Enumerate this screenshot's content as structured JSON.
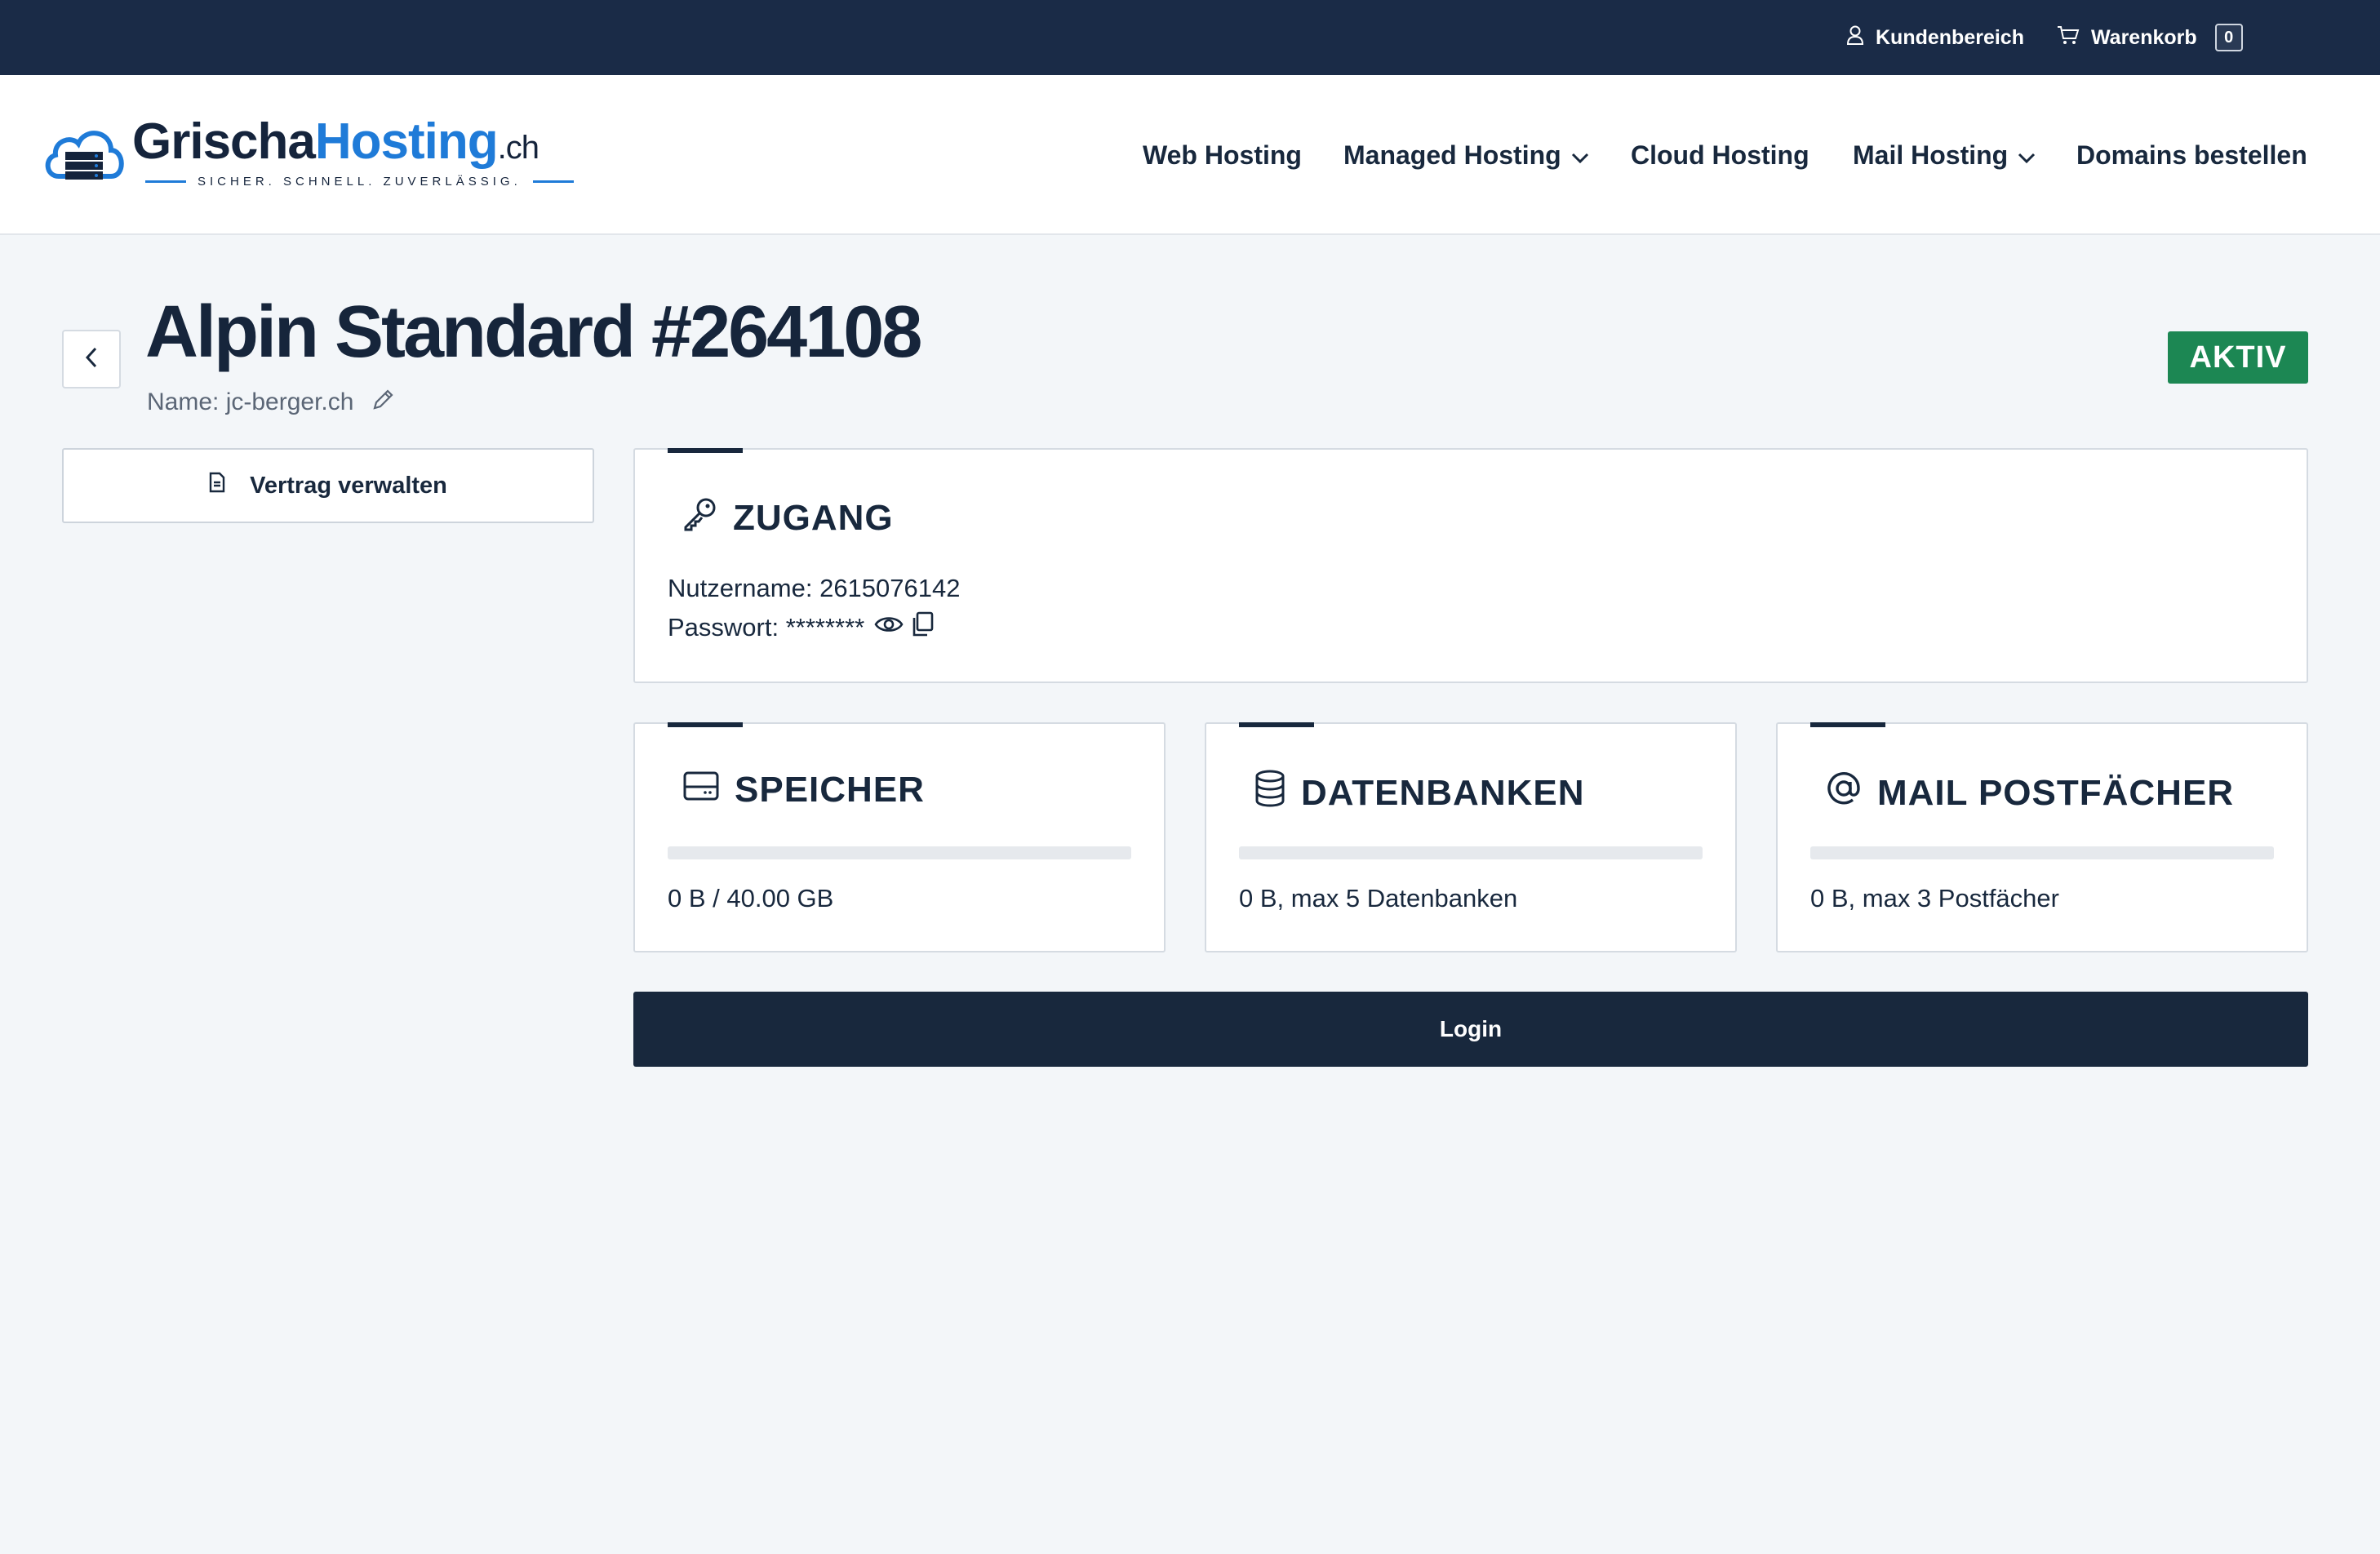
{
  "topbar": {
    "account_label": "Kundenbereich",
    "cart_label": "Warenkorb",
    "cart_count": "0",
    "account_icon": "user-icon",
    "cart_icon": "cart-icon"
  },
  "logo": {
    "part1": "Grischa",
    "part2": "Hosting",
    "part3": ".ch",
    "tagline": "SICHER. SCHNELL. ZUVERLÄSSIG."
  },
  "nav": {
    "items": [
      {
        "label": "Web Hosting",
        "has_dropdown": false
      },
      {
        "label": "Managed Hosting",
        "has_dropdown": true
      },
      {
        "label": "Cloud Hosting",
        "has_dropdown": false
      },
      {
        "label": "Mail Hosting",
        "has_dropdown": true
      },
      {
        "label": "Domains bestellen",
        "has_dropdown": false
      }
    ]
  },
  "page": {
    "title": "Alpin Standard #264108",
    "subtitle": "Name: jc-berger.ch",
    "status": "AKTIV",
    "status_color": "#1c8753"
  },
  "sidebar": {
    "manage_contract_label": "Vertrag verwalten"
  },
  "access": {
    "title": "ZUGANG",
    "username_line": "Nutzername: 2615076142",
    "password_line": "Passwort: ********"
  },
  "storage": {
    "title": "SPEICHER",
    "usage_text": "0 B / 40.00 GB",
    "usage_fraction": 0
  },
  "databases": {
    "title": "DATENBANKEN",
    "usage_text": "0 B, max 5 Datenbanken",
    "usage_fraction": 0
  },
  "mailboxes": {
    "title": "MAIL POSTFÄCHER",
    "usage_text": "0 B, max 3 Postfächer",
    "usage_fraction": 0
  },
  "login_label": "Login",
  "colors": {
    "navy": "#18283d",
    "topbar": "#1a2b47",
    "brand_blue": "#1f7bd8",
    "background": "#f3f6f9"
  }
}
